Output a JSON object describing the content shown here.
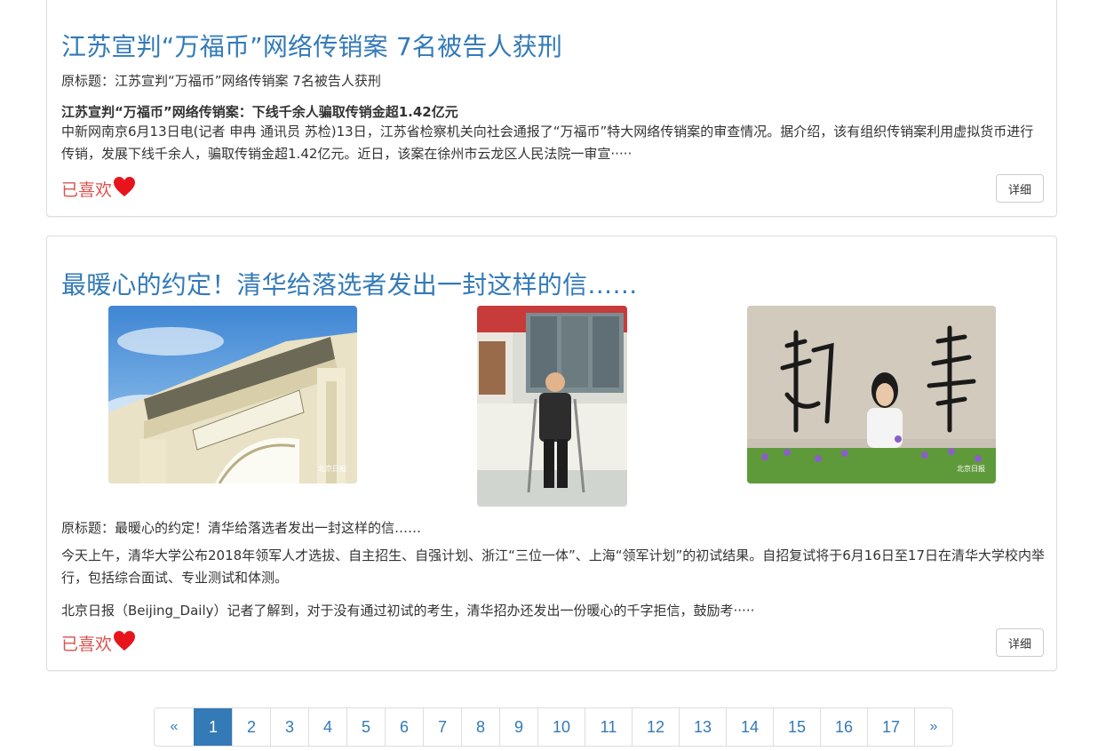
{
  "articles": [
    {
      "title": "江苏宣判“万福币”网络传销案 7名被告人获刑",
      "original_title": "原标题：江苏宣判“万福币”网络传销案 7名被告人获刑",
      "subheading": "江苏宣判“万福币”网络传销案：下线千余人骗取传销金超1.42亿元",
      "body": "中新网南京6月13日电(记者 申冉 通讯员 苏检)13日，江苏省检察机关向社会通报了“万福币”特大网络传销案的审查情况。据介绍，该有组织传销案利用虚拟货币进行传销，发展下线千余人，骗取传销金超1.42亿元。近日，该案在徐州市云龙区人民法院一审宣·····",
      "liked_label": "已喜欢",
      "detail_label": "详细"
    },
    {
      "title": "最暖心的约定！清华给落选者发出一封这样的信……",
      "images": [
        {
          "icon": "tsinghua-gate-photo",
          "watermark": "北京日报"
        },
        {
          "icon": "student-on-crutches-photo",
          "watermark": ""
        },
        {
          "icon": "student-with-calligraphy-wall-photo",
          "watermark": "北京日报"
        }
      ],
      "original_title": "原标题：最暖心的约定！清华给落选者发出一封这样的信……",
      "paragraph1": "今天上午，清华大学公布2018年领军人才选拔、自主招生、自强计划、浙江“三位一体”、上海“领军计划”的初试结果。自招复试将于6月16日至17日在清华大学校内举行，包括综合面试、专业测试和体测。",
      "paragraph2": "北京日报（Beijing_Daily）记者了解到，对于没有通过初试的考生，清华招办还发出一份暖心的千字拒信，鼓励考·····",
      "liked_label": "已喜欢",
      "detail_label": "详细"
    }
  ],
  "pagination": {
    "prev": "«",
    "next": "»",
    "pages": [
      "1",
      "2",
      "3",
      "4",
      "5",
      "6",
      "7",
      "8",
      "9",
      "10",
      "11",
      "12",
      "13",
      "14",
      "15",
      "16",
      "17"
    ],
    "active": "1"
  },
  "colors": {
    "link": "#337ab7",
    "liked": "#d9534f",
    "heart": "#e8141c"
  }
}
